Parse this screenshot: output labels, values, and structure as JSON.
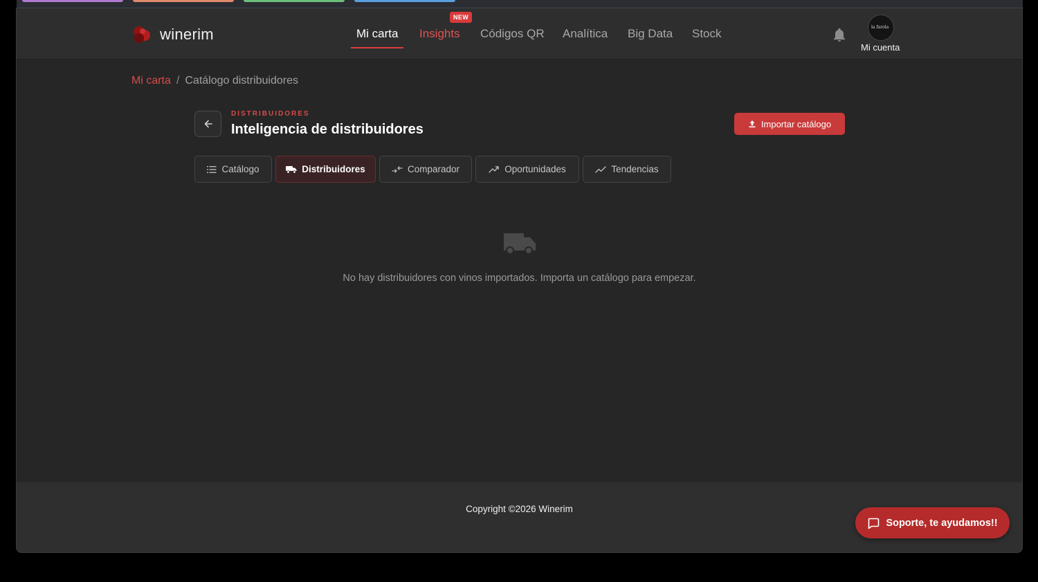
{
  "header": {
    "app_name": "winerim",
    "nav": [
      {
        "label": "Mi carta",
        "active": true
      },
      {
        "label": "Insights",
        "badge": "NEW"
      },
      {
        "label": "Códigos QR"
      },
      {
        "label": "Analítica"
      },
      {
        "label": "Big Data"
      },
      {
        "label": "Stock"
      }
    ],
    "account_label": "Mi cuenta",
    "avatar_text": "la farola"
  },
  "breadcrumb": {
    "link": "Mi carta",
    "separator": "/",
    "current": "Catálogo distribuidores"
  },
  "page": {
    "eyebrow": "DISTRIBUIDORES",
    "title": "Inteligencia de distribuidores",
    "import_button": "Importar catálogo"
  },
  "tabs": [
    {
      "label": "Catálogo",
      "icon": "list-icon"
    },
    {
      "label": "Distribuidores",
      "icon": "truck-icon",
      "active": true
    },
    {
      "label": "Comparador",
      "icon": "swap-icon"
    },
    {
      "label": "Oportunidades",
      "icon": "trend-up-icon"
    },
    {
      "label": "Tendencias",
      "icon": "chart-line-icon"
    }
  ],
  "empty_state": {
    "icon": "truck-icon",
    "message": "No hay distribuidores con vinos importados. Importa un catálogo para empezar."
  },
  "footer": {
    "copyright": "Copyright ©2026 Winerim",
    "support_button": "Soporte, te ayudamos!!"
  },
  "colors": {
    "accent": "#d84a4a",
    "button_red": "#c93a3a",
    "support_red": "#b52b2b",
    "background": "#262626",
    "header_bg": "#2e2e2e"
  }
}
